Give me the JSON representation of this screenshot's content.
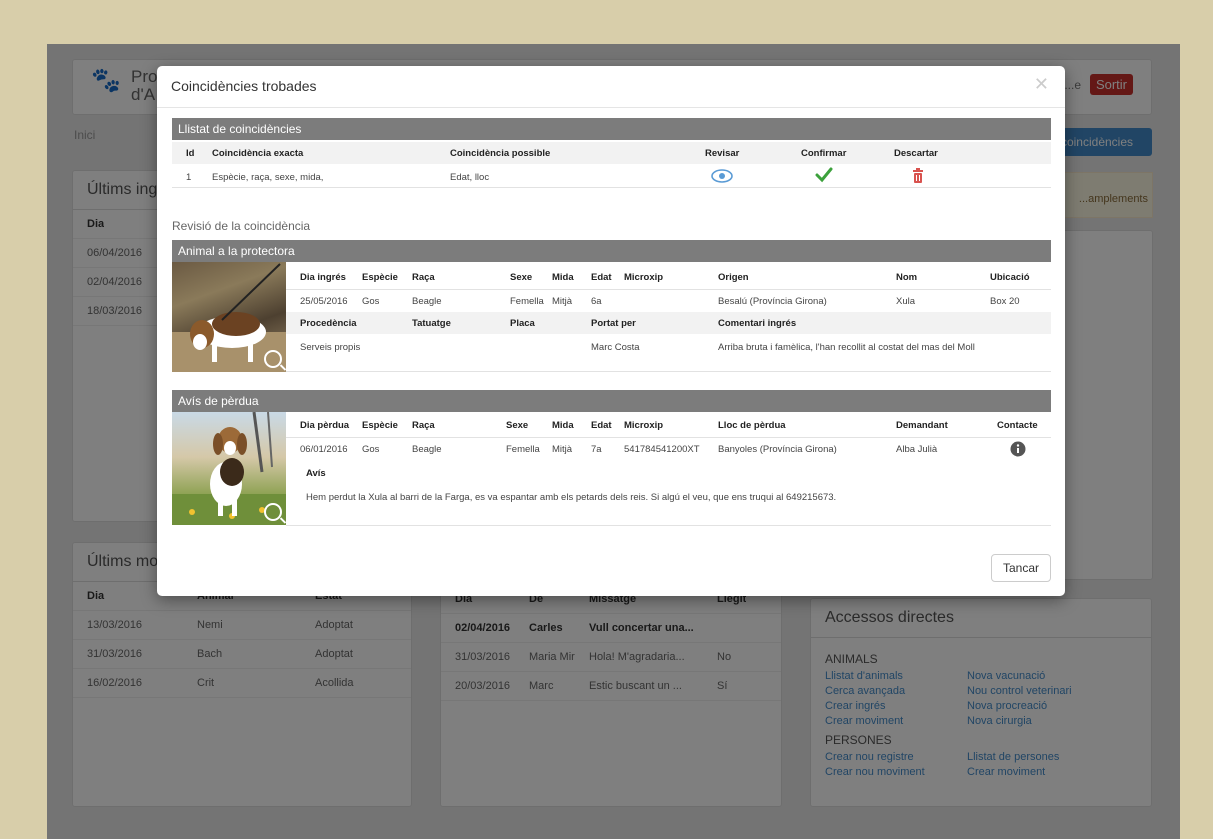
{
  "background": {
    "logo_text": "Pro\nd'A",
    "user_text": "...e",
    "exit_label": "Sortir",
    "breadcrumb": "Inici",
    "coincidences_button": "...coincidències",
    "alert_text": "...amplements",
    "last_entries": {
      "title": "Últims ing...",
      "header": "Dia",
      "rows": [
        "06/04/2016",
        "02/04/2016",
        "18/03/2016"
      ]
    },
    "last_movements": {
      "title": "Últims mo...",
      "headers": [
        "Dia",
        "Animal",
        "Estat"
      ],
      "rows": [
        [
          "13/03/2016",
          "Nemi",
          "Adoptat"
        ],
        [
          "31/03/2016",
          "Bach",
          "Adoptat"
        ],
        [
          "16/02/2016",
          "Crit",
          "Acollida"
        ]
      ]
    },
    "messages": {
      "headers": [
        "Dia",
        "De",
        "Missatge",
        "Llegit"
      ],
      "rows": [
        [
          "02/04/2016",
          "Carles",
          "Vull concertar una...",
          ""
        ],
        [
          "31/03/2016",
          "Maria Mir",
          "Hola! M'agradaria...",
          "No"
        ],
        [
          "20/03/2016",
          "Marc",
          "Estic buscant un ...",
          "Sí"
        ]
      ]
    },
    "direct_access": {
      "title": "Accessos directes",
      "animals_heading": "ANIMALS",
      "animals_links": [
        "Llistat d'animals",
        "Nova vacunació",
        "Cerca avançada",
        "Nou control veterinari",
        "Crear ingrés",
        "Nova procreació",
        "Crear moviment",
        "Nova cirurgia"
      ],
      "people_heading": "PERSONES",
      "people_links": [
        "Crear nou registre",
        "Llistat de persones",
        "Crear nou moviment",
        "Crear moviment"
      ]
    }
  },
  "modal": {
    "title": "Coincidències trobades",
    "close_symbol": "✕",
    "matches": {
      "title": "Llistat de coincidències",
      "headers": [
        "Id",
        "Coincidència exacta",
        "Coincidència possible",
        "Revisar",
        "Confirmar",
        "Descartar"
      ],
      "rows": [
        {
          "id": "1",
          "exact": "Espècie, raça, sexe, mida,",
          "possible": "Edat, lloc"
        }
      ]
    },
    "review_title": "Revisió de la coincidència",
    "shelter": {
      "title": "Animal a la protectora",
      "headers1": [
        "Dia ingrés",
        "Espècie",
        "Raça",
        "Sexe",
        "Mida",
        "Edat",
        "Microxip",
        "Origen",
        "Nom",
        "Ubicació"
      ],
      "values1": [
        "25/05/2016",
        "Gos",
        "Beagle",
        "Femella",
        "Mitjà",
        "6a",
        "",
        "Besalú (Província Girona)",
        "Xula",
        "Box 20"
      ],
      "headers2": [
        "Procedència",
        "Tatuatge",
        "Placa",
        "Portat per",
        "Comentari ingrés"
      ],
      "values2": [
        "Serveis propis",
        "",
        "",
        "Marc Costa",
        "Arriba bruta i famèlica, l'han recollit al costat del mas del Moll"
      ]
    },
    "lost": {
      "title": "Avís de pèrdua",
      "headers": [
        "Dia pèrdua",
        "Espècie",
        "Raça",
        "Sexe",
        "Mida",
        "Edat",
        "Microxip",
        "Lloc de pèrdua",
        "Demandant",
        "Contacte"
      ],
      "values": [
        "06/01/2016",
        "Gos",
        "Beagle",
        "Femella",
        "Mitjà",
        "7a",
        "541784541200XT",
        "Banyoles (Província Girona)",
        "Alba Julià",
        ""
      ],
      "notice_label": "Avís",
      "notice_text": "Hem perdut la Xula al barri de la Farga, es va espantar amb els petards dels reis. Si algú el veu, que ens truqui al 649215673."
    },
    "cancel_label": "Tancar"
  }
}
